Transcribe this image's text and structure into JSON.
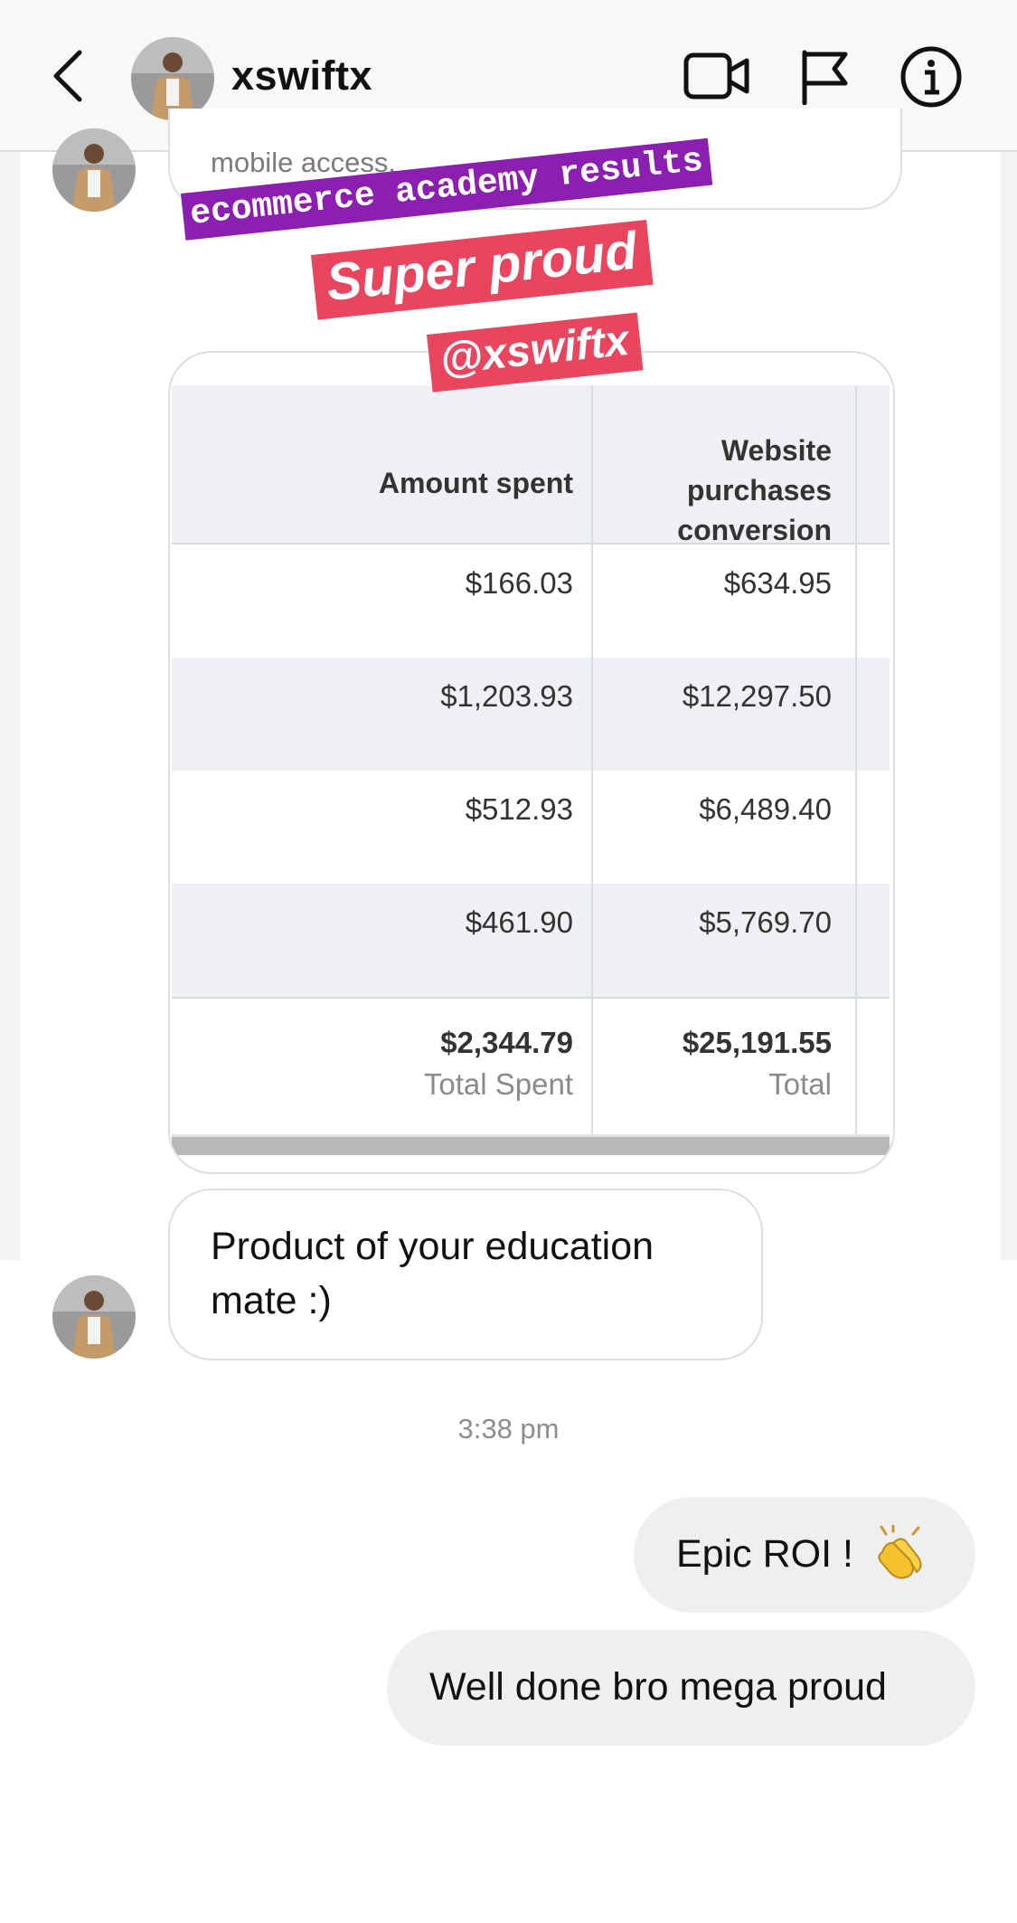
{
  "header": {
    "username": "xswiftx",
    "icons": [
      "back-arrow-icon",
      "video-call-icon",
      "flag-icon",
      "info-icon"
    ]
  },
  "messages": {
    "partial_text": "mobile access.",
    "story": {
      "tag_purple": "ecommerce academy results",
      "tag_super": "Super proud",
      "tag_user": "@xswiftx",
      "table": {
        "headers": [
          "Amount spent",
          "Website purchases conversion"
        ],
        "header_lines": [
          "Website",
          "purchases",
          "conversion"
        ],
        "rows": [
          [
            "$166.03",
            "$634.95"
          ],
          [
            "$1,203.93",
            "$12,297.50"
          ],
          [
            "$512.93",
            "$6,489.40"
          ],
          [
            "$461.90",
            "$5,769.70"
          ]
        ],
        "total": {
          "spent_value": "$2,344.79",
          "spent_label": "Total Spent",
          "conv_value": "$25,191.55",
          "conv_label": "Total"
        }
      }
    },
    "incoming_text_line1": "Product of your education",
    "incoming_text_line2": "mate :)",
    "timestamp": "3:38 pm",
    "outgoing_1": "Epic ROI ! ",
    "outgoing_2": "Well done bro mega proud"
  },
  "colors": {
    "accent_purple": "#8a1fb0",
    "accent_red": "#e8455f",
    "bubble_gray": "#efefef",
    "header_bg": "#f8f8f8"
  }
}
